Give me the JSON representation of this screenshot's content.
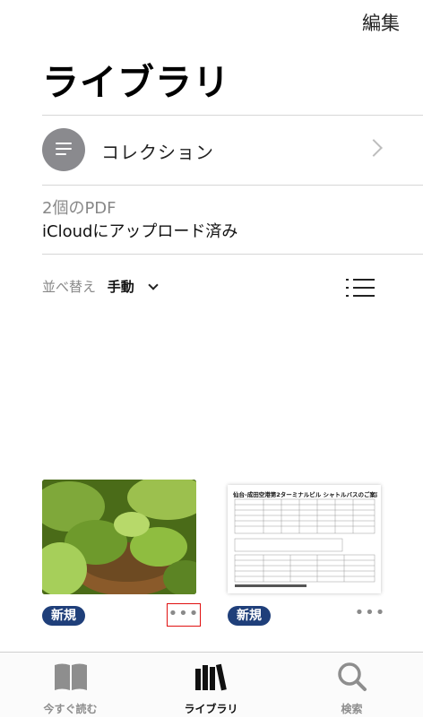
{
  "header": {
    "edit_label": "編集",
    "title": "ライブラリ"
  },
  "collections": {
    "label": "コレクション"
  },
  "info": {
    "pdf_count": "2個のPDF",
    "icloud_status": "iCloudにアップロード済み"
  },
  "sort": {
    "label": "並べ替え",
    "value": "手動"
  },
  "books": [
    {
      "badge": "新規",
      "more": "•••",
      "cover": "plant-photo"
    },
    {
      "badge": "新規",
      "more": "•••",
      "cover": "shuttle-bus-timetable",
      "cover_title": "仙台-成田空港第2ターミナルビル シャトルバスのご案内"
    }
  ],
  "tabbar": {
    "items": [
      {
        "label": "今すぐ読む",
        "icon": "book-icon"
      },
      {
        "label": "ライブラリ",
        "icon": "library-icon",
        "active": true
      },
      {
        "label": "検索",
        "icon": "search-icon"
      }
    ]
  },
  "colors": {
    "badge": "#1f3f7a",
    "highlight": "#e01010",
    "accent_gray": "#8a8a8e"
  }
}
